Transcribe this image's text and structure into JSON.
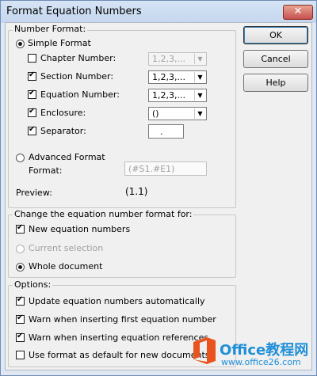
{
  "window": {
    "title": "Format Equation Numbers",
    "close_glyph": "✕"
  },
  "number_format": {
    "legend": "Number Format:",
    "simple_format": "Simple Format",
    "chapter_number": {
      "label": "Chapter Number:",
      "value": "1,2,3,..."
    },
    "section_number": {
      "label": "Section Number:",
      "value": "1,2,3,..."
    },
    "equation_number": {
      "label": "Equation Number:",
      "value": "1,2,3,..."
    },
    "enclosure": {
      "label": "Enclosure:",
      "value": "()"
    },
    "separator": {
      "label": "Separator:",
      "value": "."
    },
    "advanced_format": "Advanced Format",
    "format_label": "Format:",
    "format_value": "(#S1.#E1)",
    "preview_label": "Preview:",
    "preview_value": "(1.1)"
  },
  "change_for": {
    "legend": "Change the equation number format for:",
    "new_equations": "New equation numbers",
    "current_selection": "Current selection",
    "whole_document": "Whole document"
  },
  "options": {
    "legend": "Options:",
    "update_auto": "Update equation numbers automatically",
    "warn_first": "Warn when inserting first equation number",
    "warn_refs": "Warn when inserting equation references",
    "use_default": "Use format as default for new documents"
  },
  "buttons": {
    "ok": "OK",
    "cancel": "Cancel",
    "help": "Help"
  },
  "watermark": {
    "brand": "Office教程网",
    "url": "www.office26.com"
  },
  "colors": {
    "logo_orange": "#e8531e",
    "watermark_text": "#1f8fd8"
  }
}
